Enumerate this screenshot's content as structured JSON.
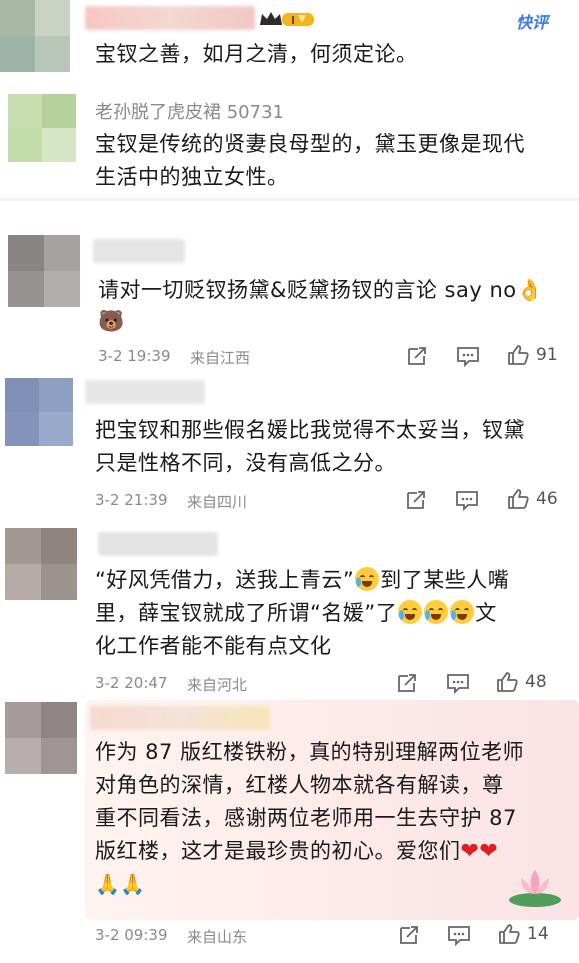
{
  "comments": [
    {
      "username": "",
      "action_label": "快评",
      "text": "宝钗之善，如月之清，何须定论。"
    },
    {
      "username": "老孙脱了虎皮裙 50731",
      "text_lines": [
        "宝钗是传统的贤妻良母型的，黛玉更像是现代",
        "生活中的独立女性。"
      ]
    },
    {
      "text_lines": [
        "请对一切贬钗扬黛&贬黛扬钗的言论 say no👌",
        "🐻"
      ],
      "date": "3-2 19:39",
      "location": "来自江西",
      "likes": "91"
    },
    {
      "text_lines": [
        "把宝钗和那些假名媛比我觉得不太妥当，钗黛",
        "只是性格不同，没有高低之分。"
      ],
      "date": "3-2 21:39",
      "location": "来自四川",
      "likes": "46"
    },
    {
      "text_line1": "“好风凭借力，送我上青云”",
      "text_line1_tail": "到了某些人嘴",
      "text_line2_head": "里，薛宝钗就成了所谓“名媛”了",
      "text_line2_tail": "文",
      "text_line3": "化工作者能不能有点文化",
      "date": "3-2 20:47",
      "location": "来自河北",
      "likes": "48"
    },
    {
      "text_lines": [
        "作为 87 版红楼铁粉，真的特别理解两位老师",
        "对角色的深情，红楼人物本就各有解读，尊",
        "重不同看法，感谢两位老师用一生去守护 87",
        "版红楼，这才是最珍贵的初心。爱您们"
      ],
      "text_hearts": "❤❤",
      "text_hands": "🙏🙏",
      "date": "3-2 09:39",
      "location": "来自山东",
      "likes": "14"
    }
  ],
  "icons": {
    "share": "share-icon",
    "comment": "comment-icon",
    "like": "thumbs-up-icon",
    "badge": "crown-badge-icon",
    "lotus": "lotus-icon"
  },
  "colors": {
    "accent_blue": "#3d7be8",
    "badge_gold": "#f2b51c",
    "heart_red": "#e02020"
  }
}
